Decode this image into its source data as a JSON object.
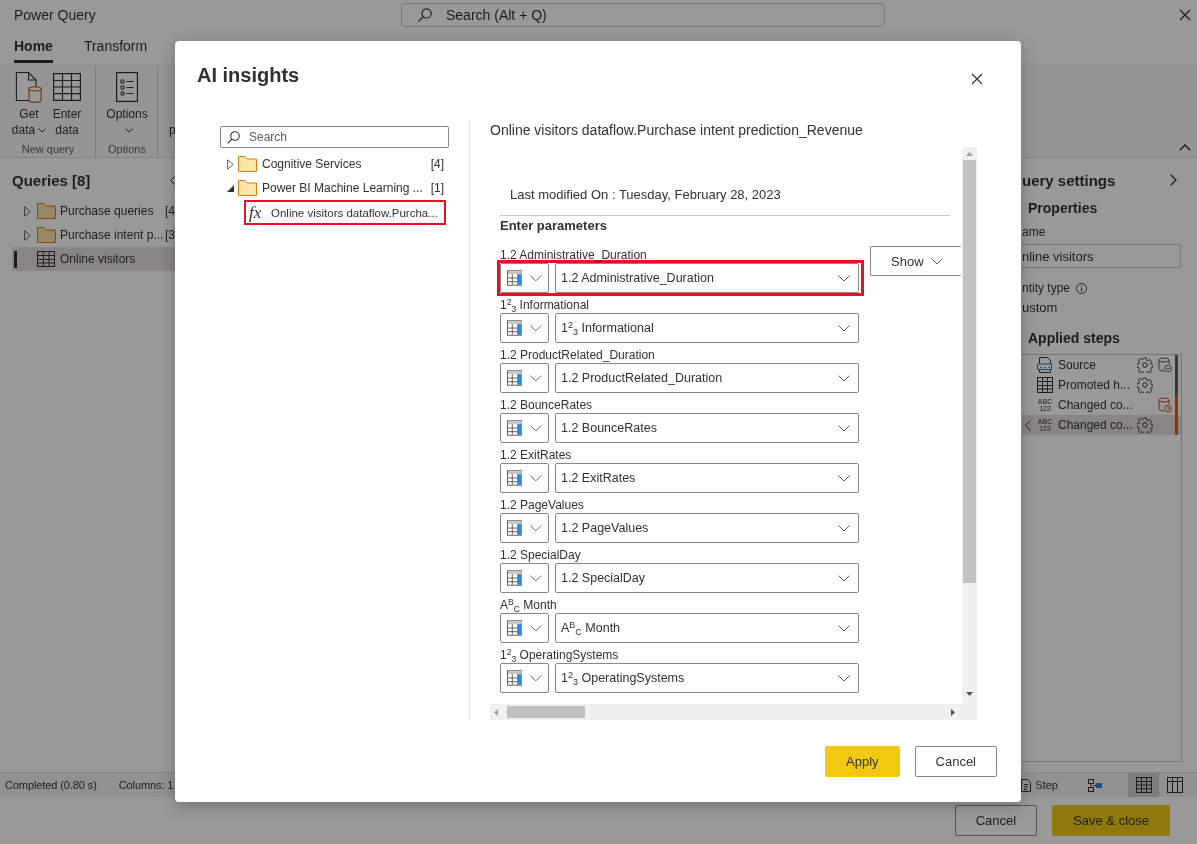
{
  "window": {
    "title": "Power Query",
    "search_placeholder": "Search (Alt + Q)"
  },
  "ribbon": {
    "tabs": [
      {
        "label": "Home",
        "selected": true
      },
      {
        "label": "Transform",
        "selected": false
      }
    ],
    "groups": [
      {
        "label": "New query",
        "buttons": [
          {
            "kind": "get-data",
            "label": "Get data",
            "dropdown": true
          },
          {
            "kind": "enter-data",
            "label": "Enter data",
            "dropdown": false
          }
        ]
      },
      {
        "label": "Options",
        "buttons": [
          {
            "kind": "options",
            "label": "Options",
            "dropdown": true
          }
        ]
      },
      {
        "buttons": [
          {
            "kind": "partial",
            "label": "p",
            "dropdown": false
          }
        ]
      }
    ]
  },
  "queries": {
    "title": "Queries [8]",
    "items": [
      {
        "kind": "folder",
        "label": "Purchase queries",
        "count": "[4",
        "expanded": false,
        "selected": false
      },
      {
        "kind": "folder",
        "label": "Purchase intent p...",
        "count": "[3",
        "expanded": false,
        "selected": false
      },
      {
        "kind": "table",
        "label": "Online visitors",
        "selected": true
      }
    ]
  },
  "query_settings": {
    "title": "uery settings",
    "properties_heading": "Properties",
    "name_label": "ame",
    "name_value": "nline visitors",
    "entity_type_label": "ntity type",
    "entity_type_value": "ustom",
    "steps_heading": "Applied steps",
    "steps": [
      {
        "kind": "csv",
        "label": "Source",
        "settings": true,
        "cached": true,
        "cache_error": false,
        "color": "#3a3837",
        "selected": false
      },
      {
        "kind": "table",
        "label": "Promoted h...",
        "settings": true,
        "cached": false,
        "color": "#3a3837",
        "selected": false
      },
      {
        "kind": "type",
        "type_icon": [
          "ABC",
          "123"
        ],
        "label": "Changed co...",
        "settings": false,
        "cached": true,
        "cache_error": true,
        "color": "#8b3507",
        "selected": false
      },
      {
        "kind": "type",
        "type_icon": [
          "ABC",
          "123"
        ],
        "label": "Changed co...",
        "settings": true,
        "cached": false,
        "color": "#8b3507",
        "selected": true
      }
    ]
  },
  "status_bar": {
    "texts": [
      "Completed (0.80 s)",
      "Columns: 1"
    ],
    "step_button": "Step",
    "views": [
      {
        "kind": "diagram",
        "selected": false
      },
      {
        "kind": "data",
        "selected": true
      },
      {
        "kind": "schema",
        "selected": false
      }
    ]
  },
  "footer": {
    "buttons": [
      {
        "kind": "secondary",
        "label": "Cancel"
      },
      {
        "kind": "primary",
        "label": "Save & close"
      }
    ]
  },
  "dialog": {
    "title": "AI insights",
    "search_placeholder": "Search",
    "tree": [
      {
        "kind": "folder",
        "label": "Cognitive Services",
        "count": "[4]",
        "expanded": false
      },
      {
        "kind": "folder",
        "label": "Power BI Machine Learning ...",
        "count": "[1]",
        "expanded": true,
        "children": [
          {
            "kind": "function",
            "icon": "fx",
            "label": "Online visitors dataflow.Purcha...",
            "highlighted": true
          }
        ]
      }
    ],
    "function_title": "Online visitors dataflow.Purchase intent prediction_Revenue",
    "last_modified": "Last modified On : Tuesday, February 28, 2023",
    "parameters_heading": "Enter parameters",
    "show_button": "Show",
    "parameters": [
      {
        "label": "1.2 Administrative_Duration",
        "value": "1.2 Administrative_Duration",
        "highlighted": true
      },
      {
        "label": "1$^{2}$$_{3}$ Informational",
        "value": "1$^{2}$$_{3}$ Informational",
        "highlighted": false
      },
      {
        "label": "1.2 ProductRelated_Duration",
        "value": "1.2 ProductRelated_Duration",
        "highlighted": false
      },
      {
        "label": "1.2 BounceRates",
        "value": "1.2 BounceRates",
        "highlighted": false
      },
      {
        "label": "1.2 ExitRates",
        "value": "1.2 ExitRates",
        "highlighted": false
      },
      {
        "label": "1.2 PageValues",
        "value": "1.2 PageValues",
        "highlighted": false
      },
      {
        "label": "1.2 SpecialDay",
        "value": "1.2 SpecialDay",
        "highlighted": false
      },
      {
        "label": "A$^{B}$$_{C}$ Month",
        "value": "A$^{B}$$_{C}$ Month",
        "highlighted": false
      },
      {
        "label": "1$^{2}$$_{3}$ OperatingSystems",
        "value": "1$^{2}$$_{3}$ OperatingSystems",
        "highlighted": false
      }
    ],
    "buttons": [
      {
        "kind": "primary",
        "label": "Apply"
      },
      {
        "kind": "secondary",
        "label": "Cancel"
      }
    ]
  }
}
